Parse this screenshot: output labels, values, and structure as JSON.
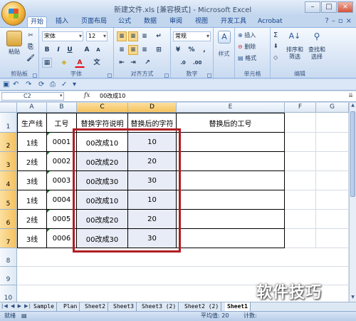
{
  "window": {
    "title": "新建文件.xls [兼容模式] - Microsoft Excel"
  },
  "ribbon_tabs": [
    "开始",
    "插入",
    "页面布局",
    "公式",
    "数据",
    "审阅",
    "视图",
    "开发工具",
    "Acrobat"
  ],
  "ribbon": {
    "clipboard": {
      "paste": "粘贴",
      "label": "剪贴板"
    },
    "font": {
      "name": "宋体",
      "size": "12",
      "bold": "B",
      "italic": "I",
      "underline": "U",
      "grow": "A",
      "shrink": "A",
      "font_color": "A",
      "label": "字体"
    },
    "alignment": {
      "label": "对齐方式"
    },
    "number": {
      "format": "常规",
      "percent": "%",
      "comma": ",",
      "label": "数字"
    },
    "styles": {
      "label": "样式"
    },
    "cells": {
      "insert": "插入",
      "delete": "删除",
      "format": "格式",
      "label": "单元格"
    },
    "editing": {
      "sigma": "Σ",
      "sort": "排序和\n筛选",
      "find": "查找和\n选择",
      "label": "编辑"
    }
  },
  "formula_bar": {
    "name_box": "C2",
    "fx": "fx",
    "content": "00改成10"
  },
  "columns": [
    "A",
    "B",
    "C",
    "D",
    "E",
    "F",
    "G"
  ],
  "rows": [
    "1",
    "2",
    "3",
    "4",
    "5",
    "6",
    "7",
    "8",
    "9",
    "10"
  ],
  "headers": [
    "生产线",
    "工号",
    "替换字符说明",
    "替换后的字符",
    "替换后的工号"
  ],
  "data_rows": [
    [
      "1线",
      "0001",
      "00改成10",
      "10"
    ],
    [
      "2线",
      "0002",
      "00改成20",
      "20"
    ],
    [
      "3线",
      "0003",
      "00改成30",
      "30"
    ],
    [
      "1线",
      "0004",
      "00改成10",
      "10"
    ],
    [
      "2线",
      "0005",
      "00改成20",
      "20"
    ],
    [
      "3线",
      "0006",
      "00改成30",
      "30"
    ]
  ],
  "sheet_tabs": [
    "Sample",
    "Plan",
    "Sheet2",
    "Sheet3",
    "Sheet3 (2)",
    "Sheet2 (2)",
    "Sheet1"
  ],
  "status": {
    "mode": "就绪",
    "average": "平均值: 20",
    "count": "计数:"
  },
  "watermark": "软件技巧",
  "colors": {
    "highlight_box": "#b01e24",
    "selection_fill": "#e8ecf6",
    "header_selected": "#f5c15d"
  }
}
